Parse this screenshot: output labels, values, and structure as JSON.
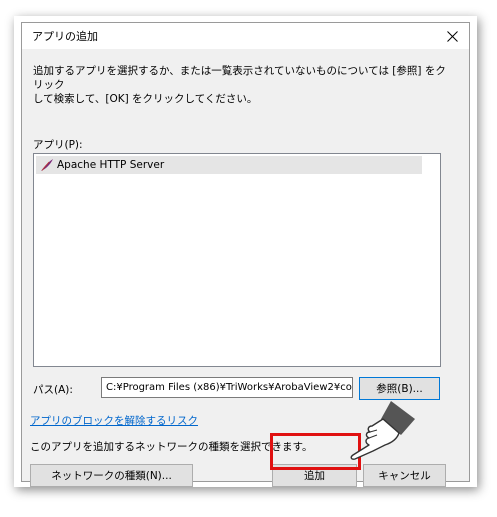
{
  "dialog": {
    "title": "アプリの追加",
    "instruction": "追加するアプリを選択するか、または一覧表示されていないものについては [参照] をクリック\nして検索して、[OK] をクリックしてください。",
    "apps_label": "アプリ(P):",
    "apps": [
      {
        "name": "Apache HTTP Server",
        "icon": "feather-icon",
        "selected": true
      }
    ],
    "path_label": "パス(A):",
    "path_value": "C:¥Program Files (x86)¥TriWorks¥ArobaView2¥co",
    "browse_label": "参照(B)...",
    "unblock_link": "アプリのブロックを解除するリスク",
    "network_desc": "このアプリを追加するネットワークの種類を選択できます。",
    "network_button": "ネットワークの種類(N)...",
    "add_button": "追加",
    "cancel_button": "キャンセル"
  },
  "annotation": {
    "highlight_color": "#e01010",
    "pointer": "pointing-hand-icon"
  },
  "colors": {
    "link": "#0066cc",
    "client_bg": "#f0f0f0",
    "focus_border": "#0078d7"
  }
}
